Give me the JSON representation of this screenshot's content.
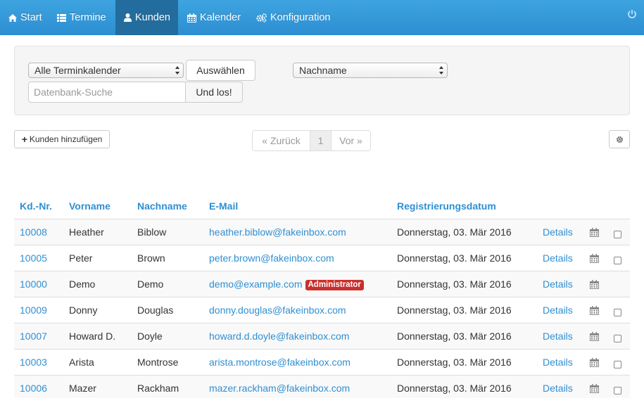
{
  "nav": {
    "items": [
      {
        "label": "Start",
        "icon": "home-icon"
      },
      {
        "label": "Termine",
        "icon": "list-icon"
      },
      {
        "label": "Kunden",
        "icon": "user-icon"
      },
      {
        "label": "Kalender",
        "icon": "calendar-icon"
      },
      {
        "label": "Konfiguration",
        "icon": "gears-icon"
      }
    ],
    "active": "Kunden"
  },
  "filters": {
    "calendar_select": "Alle Terminkalender",
    "select_button": "Auswählen",
    "search_placeholder": "Datenbank-Suche",
    "search_button": "Und los!",
    "sort_select": "Nachname"
  },
  "toolbar": {
    "add_button": "Kunden hinzufügen",
    "pager_prev": "« Zurück",
    "pager_page": "1",
    "pager_next": "Vor »"
  },
  "table": {
    "headers": [
      "Kd.-Nr.",
      "Vorname",
      "Nachname",
      "E-Mail",
      "Registrierungsdatum"
    ],
    "details_label": "Details",
    "rows": [
      {
        "id": "10008",
        "first": "Heather",
        "last": "Biblow",
        "email": "heather.biblow@fakeinbox.com",
        "badge": "",
        "date": "Donnerstag, 03. Mär 2016",
        "checkbox": true
      },
      {
        "id": "10005",
        "first": "Peter",
        "last": "Brown",
        "email": "peter.brown@fakeinbox.com",
        "badge": "",
        "date": "Donnerstag, 03. Mär 2016",
        "checkbox": true
      },
      {
        "id": "10000",
        "first": "Demo",
        "last": "Demo",
        "email": "demo@example.com",
        "badge": "Administrator",
        "date": "Donnerstag, 03. Mär 2016",
        "checkbox": false
      },
      {
        "id": "10009",
        "first": "Donny",
        "last": "Douglas",
        "email": "donny.douglas@fakeinbox.com",
        "badge": "",
        "date": "Donnerstag, 03. Mär 2016",
        "checkbox": true
      },
      {
        "id": "10007",
        "first": "Howard D.",
        "last": "Doyle",
        "email": "howard.d.doyle@fakeinbox.com",
        "badge": "",
        "date": "Donnerstag, 03. Mär 2016",
        "checkbox": true
      },
      {
        "id": "10003",
        "first": "Arista",
        "last": "Montrose",
        "email": "arista.montrose@fakeinbox.com",
        "badge": "",
        "date": "Donnerstag, 03. Mär 2016",
        "checkbox": true
      },
      {
        "id": "10006",
        "first": "Mazer",
        "last": "Rackham",
        "email": "mazer.rackham@fakeinbox.com",
        "badge": "",
        "date": "Donnerstag, 03. Mär 2016",
        "checkbox": true
      }
    ]
  },
  "colors": {
    "navbar": "#2c8ed2",
    "navbar_active": "#226d9e",
    "link": "#2f8fd3",
    "badge": "#c9302c"
  }
}
